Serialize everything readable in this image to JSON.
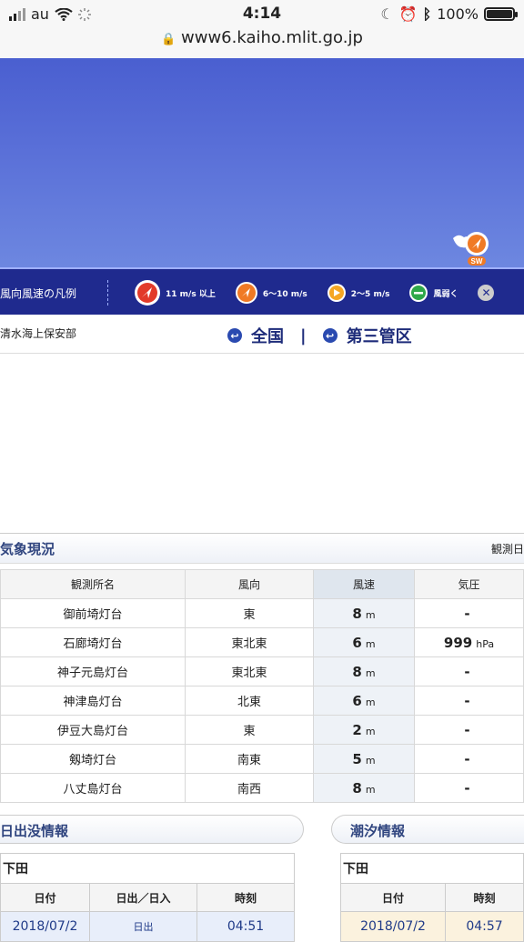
{
  "status": {
    "carrier": "au",
    "time": "4:14",
    "battery": "100%",
    "url": "www6.kaiho.mlit.go.jp"
  },
  "map": {
    "wind_badge": "SW"
  },
  "legend": {
    "title": "風向風速の凡例",
    "items": [
      {
        "label": "11 m/s 以上",
        "color": "#e23a2a"
      },
      {
        "label": "6〜10 m/s",
        "color": "#f07a25"
      },
      {
        "label": "2〜5 m/s",
        "color": "#f5a623"
      },
      {
        "label": "風弱く",
        "color": "#2ea84a"
      }
    ]
  },
  "region": {
    "office": "清水海上保安部",
    "link_national": "全国",
    "divider": "|",
    "link_district": "第三管区"
  },
  "weather": {
    "title": "気象現況",
    "right_label": "観測日",
    "columns": [
      "観測所名",
      "風向",
      "風速",
      "気圧"
    ],
    "rows": [
      {
        "name": "御前埼灯台",
        "dir": "東",
        "speed": "8",
        "speed_unit": "m",
        "pressure": "-",
        "pressure_unit": ""
      },
      {
        "name": "石廊埼灯台",
        "dir": "東北東",
        "speed": "6",
        "speed_unit": "m",
        "pressure": "999",
        "pressure_unit": "hPa"
      },
      {
        "name": "神子元島灯台",
        "dir": "東北東",
        "speed": "8",
        "speed_unit": "m",
        "pressure": "-",
        "pressure_unit": ""
      },
      {
        "name": "神津島灯台",
        "dir": "北東",
        "speed": "6",
        "speed_unit": "m",
        "pressure": "-",
        "pressure_unit": ""
      },
      {
        "name": "伊豆大島灯台",
        "dir": "東",
        "speed": "2",
        "speed_unit": "m",
        "pressure": "-",
        "pressure_unit": ""
      },
      {
        "name": "剱埼灯台",
        "dir": "南東",
        "speed": "5",
        "speed_unit": "m",
        "pressure": "-",
        "pressure_unit": ""
      },
      {
        "name": "八丈島灯台",
        "dir": "南西",
        "speed": "8",
        "speed_unit": "m",
        "pressure": "-",
        "pressure_unit": ""
      }
    ]
  },
  "sun": {
    "title": "日出没情報",
    "location": "下田",
    "columns": [
      "日付",
      "日出／日入",
      "時刻"
    ],
    "row": {
      "date": "2018/07/2",
      "event": "日出",
      "time": "04:51"
    }
  },
  "tide": {
    "title": "潮汐情報",
    "location": "下田",
    "columns": [
      "日付",
      "時刻"
    ],
    "row": {
      "date": "2018/07/2",
      "time": "04:57"
    }
  }
}
